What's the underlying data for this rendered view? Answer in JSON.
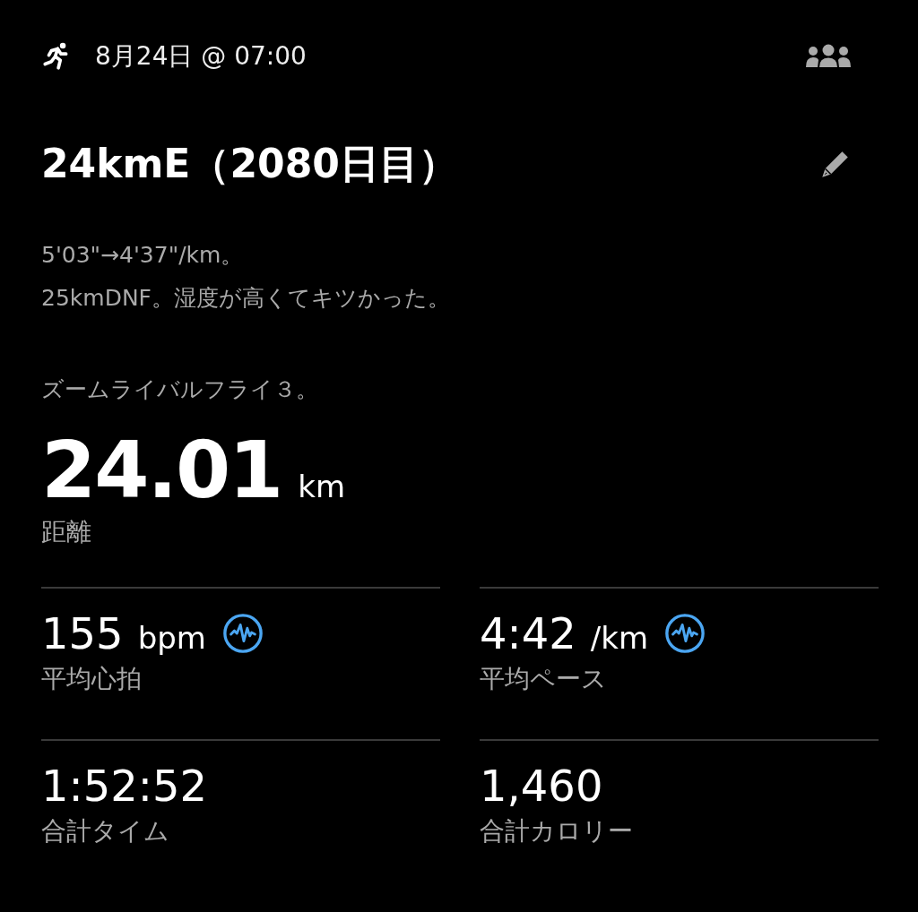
{
  "header": {
    "datetime": "8月24日 @ 07:00"
  },
  "title": "24kmE（2080日目）",
  "description": [
    {
      "lines": [
        "5'03\"→4'37\"/km。",
        "25kmDNF。湿度が高くてキツかった。"
      ]
    },
    {
      "lines": [
        "ズームライバルフライ３。"
      ]
    }
  ],
  "distance": {
    "value": "24.01",
    "unit": "km",
    "label": "距離"
  },
  "stats": [
    {
      "value": "155",
      "unit": "bpm",
      "label": "平均心拍",
      "graph_icon": true
    },
    {
      "value": "4:42",
      "unit": "/km",
      "label": "平均ペース",
      "graph_icon": true
    },
    {
      "value": "1:52:52",
      "label": "合計タイム",
      "graph_icon": false
    },
    {
      "value": "1,460",
      "label": "合計カロリー",
      "graph_icon": false
    }
  ]
}
